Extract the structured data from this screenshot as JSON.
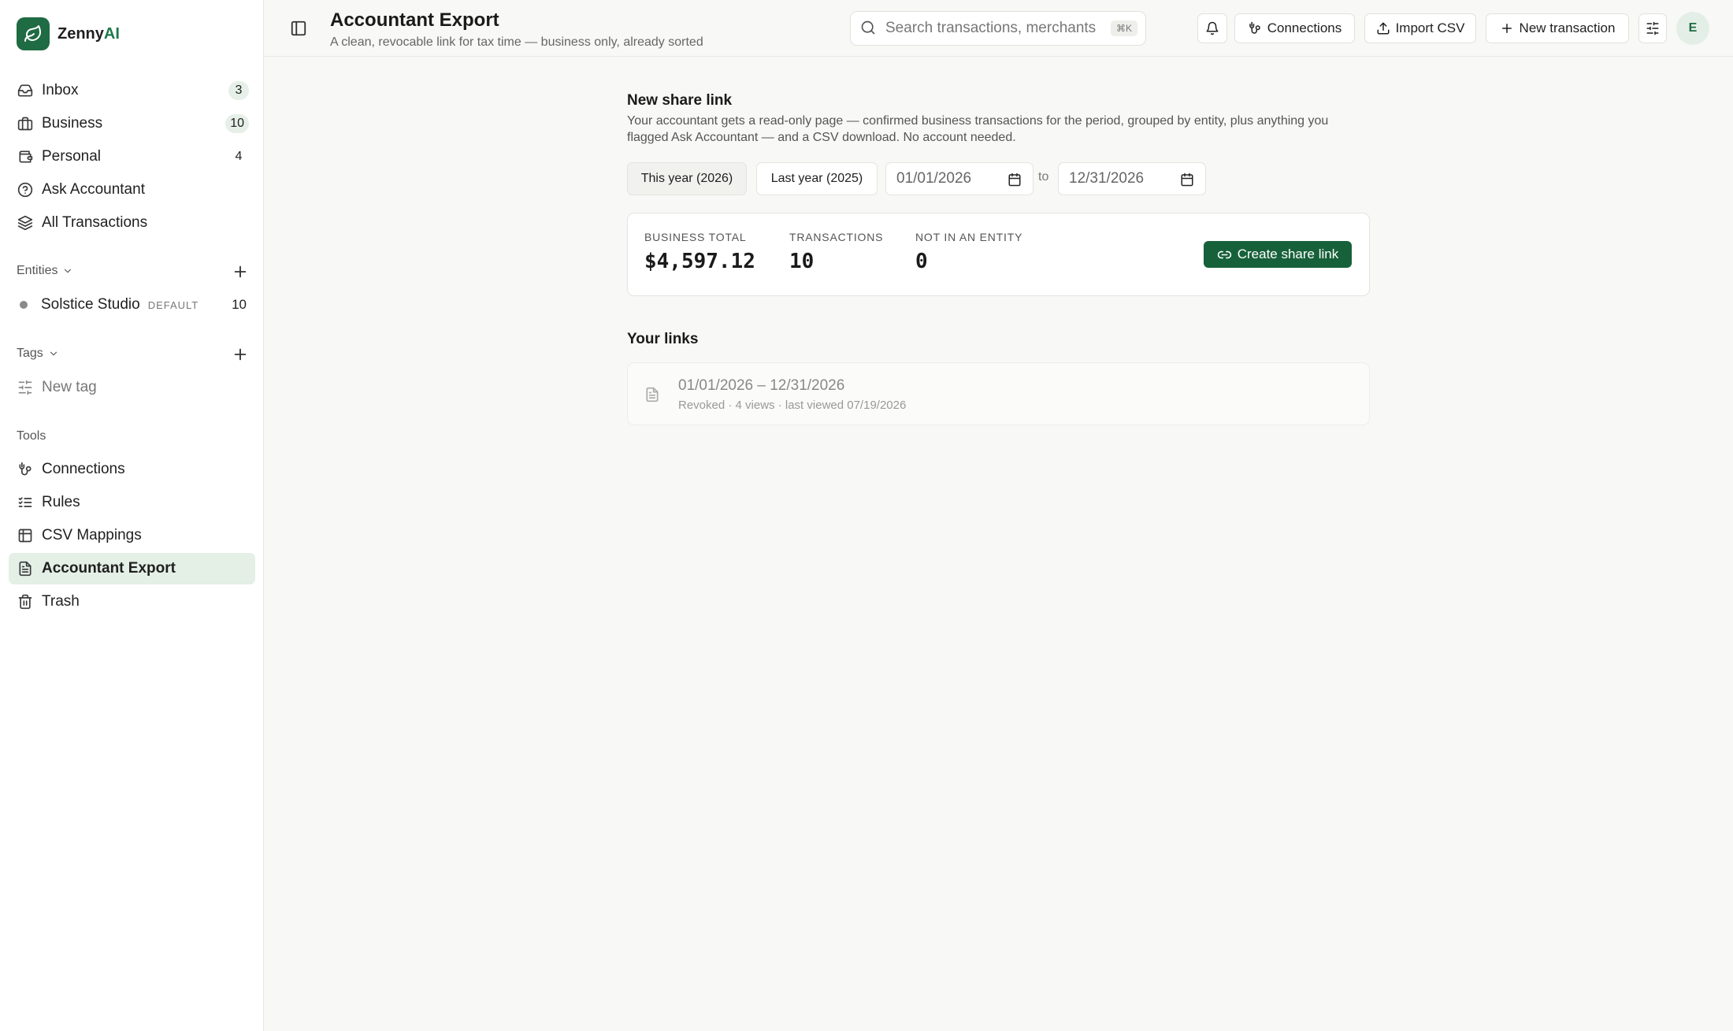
{
  "brand": {
    "name_prefix": "Zenny",
    "name_suffix": "AI"
  },
  "sidebar": {
    "nav": [
      {
        "label": "Inbox",
        "count": "3",
        "icon": "inbox-icon"
      },
      {
        "label": "Business",
        "count": "10",
        "icon": "briefcase-icon"
      },
      {
        "label": "Personal",
        "count": "4",
        "icon": "wallet-icon"
      },
      {
        "label": "Ask Accountant",
        "count": "",
        "icon": "help-circle-icon"
      },
      {
        "label": "All Transactions",
        "count": "",
        "icon": "layers-icon"
      }
    ],
    "entities_label": "Entities",
    "entities": [
      {
        "name": "Solstice Studio",
        "tag": "DEFAULT",
        "count": "10"
      }
    ],
    "tags_label": "Tags",
    "new_tag_label": "New tag",
    "tools_label": "Tools",
    "tools": [
      {
        "label": "Connections",
        "icon": "connections-icon"
      },
      {
        "label": "Rules",
        "icon": "list-checks-icon"
      },
      {
        "label": "CSV Mappings",
        "icon": "table-icon"
      },
      {
        "label": "Accountant Export",
        "icon": "file-text-icon",
        "active": true
      },
      {
        "label": "Trash",
        "icon": "trash-icon"
      }
    ]
  },
  "header": {
    "title": "Accountant Export",
    "subtitle": "A clean, revocable link for tax time — business only, already sorted",
    "search_placeholder": "Search transactions, merchants",
    "search_shortcut": "⌘K",
    "connections_label": "Connections",
    "import_label": "Import CSV",
    "new_transaction_label": "New transaction",
    "avatar_initial": "E"
  },
  "share": {
    "title": "New share link",
    "description": "Your accountant gets a read-only page — confirmed business transactions for the period, grouped by entity, plus anything you flagged Ask Accountant — and a CSV download. No account needed.",
    "presets": [
      "This year (2026)",
      "Last year (2025)"
    ],
    "active_preset": 0,
    "start_date": "01/01/2026",
    "to_label": "to",
    "end_date": "12/31/2026",
    "stats": {
      "business_total_label": "BUSINESS TOTAL",
      "business_total_value": "$4,597.12",
      "transactions_label": "TRANSACTIONS",
      "transactions_value": "10",
      "not_in_entity_label": "NOT IN AN ENTITY",
      "not_in_entity_value": "0"
    },
    "create_label": "Create share link"
  },
  "links": {
    "title": "Your links",
    "items": [
      {
        "range": "01/01/2026 – 12/31/2026",
        "meta": "Revoked · 4 views · last viewed 07/19/2026"
      }
    ]
  },
  "colors": {
    "brand_green": "#1f6b43",
    "primary_button": "#17613a",
    "active_nav_bg": "#e4efe6",
    "count_pill_bg": "#e6f0e9"
  }
}
